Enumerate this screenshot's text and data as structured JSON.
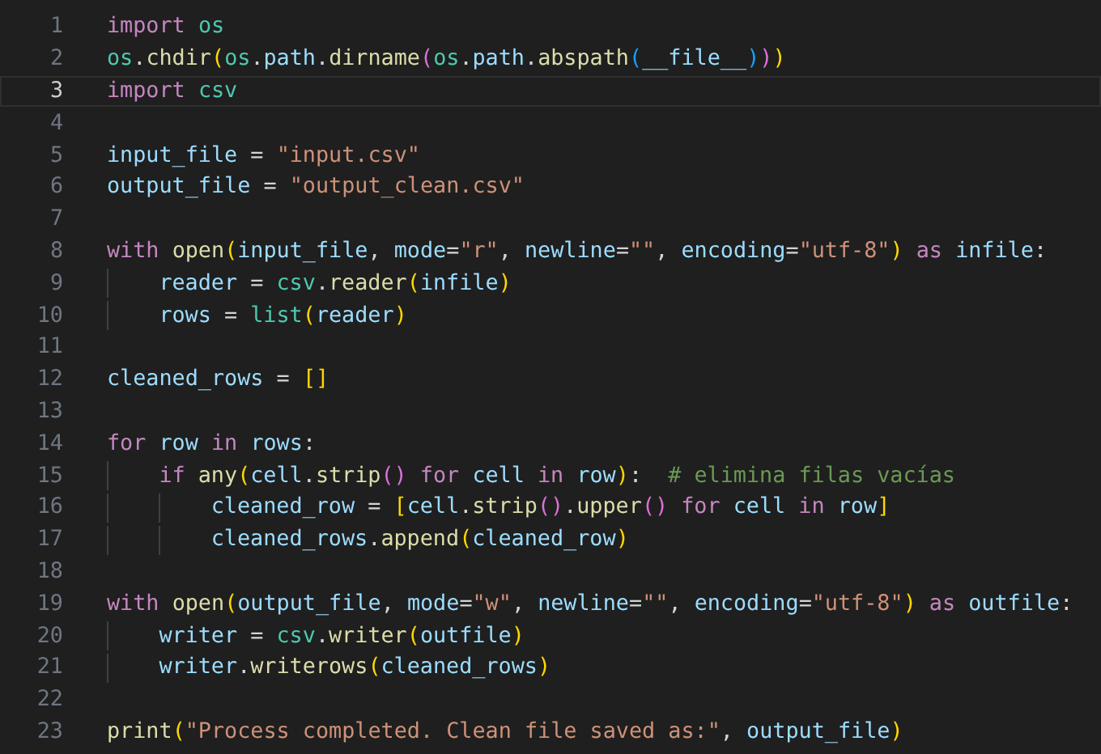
{
  "editor": {
    "lines": [
      {
        "number": "1",
        "current": false,
        "tokens": [
          {
            "kind": "kw",
            "text": "import "
          },
          {
            "kind": "mod",
            "text": "os"
          }
        ]
      },
      {
        "number": "2",
        "current": false,
        "tokens": [
          {
            "kind": "mod",
            "text": "os"
          },
          {
            "kind": "p",
            "text": "."
          },
          {
            "kind": "fn",
            "text": "chdir"
          },
          {
            "kind": "b1",
            "text": "("
          },
          {
            "kind": "mod",
            "text": "os"
          },
          {
            "kind": "p",
            "text": "."
          },
          {
            "kind": "var",
            "text": "path"
          },
          {
            "kind": "p",
            "text": "."
          },
          {
            "kind": "fn",
            "text": "dirname"
          },
          {
            "kind": "b2",
            "text": "("
          },
          {
            "kind": "mod",
            "text": "os"
          },
          {
            "kind": "p",
            "text": "."
          },
          {
            "kind": "var",
            "text": "path"
          },
          {
            "kind": "p",
            "text": "."
          },
          {
            "kind": "fn",
            "text": "abspath"
          },
          {
            "kind": "b3",
            "text": "("
          },
          {
            "kind": "var",
            "text": "__file__"
          },
          {
            "kind": "b3",
            "text": ")"
          },
          {
            "kind": "b2",
            "text": ")"
          },
          {
            "kind": "b1",
            "text": ")"
          }
        ]
      },
      {
        "number": "3",
        "current": true,
        "tokens": [
          {
            "kind": "kw",
            "text": "import "
          },
          {
            "kind": "mod",
            "text": "csv"
          }
        ]
      },
      {
        "number": "4",
        "current": false
      },
      {
        "number": "5",
        "current": false,
        "tokens": [
          {
            "kind": "var",
            "text": "input_file"
          },
          {
            "kind": "p",
            "text": " = "
          },
          {
            "kind": "str",
            "text": "\"input.csv\""
          }
        ]
      },
      {
        "number": "6",
        "current": false,
        "tokens": [
          {
            "kind": "var",
            "text": "output_file"
          },
          {
            "kind": "p",
            "text": " = "
          },
          {
            "kind": "str",
            "text": "\"output_clean.csv\""
          }
        ]
      },
      {
        "number": "7",
        "current": false
      },
      {
        "number": "8",
        "current": false,
        "tokens": [
          {
            "kind": "kw",
            "text": "with "
          },
          {
            "kind": "fn",
            "text": "open"
          },
          {
            "kind": "b1",
            "text": "("
          },
          {
            "kind": "var",
            "text": "input_file"
          },
          {
            "kind": "p",
            "text": ", "
          },
          {
            "kind": "var",
            "text": "mode"
          },
          {
            "kind": "p",
            "text": "="
          },
          {
            "kind": "str",
            "text": "\"r\""
          },
          {
            "kind": "p",
            "text": ", "
          },
          {
            "kind": "var",
            "text": "newline"
          },
          {
            "kind": "p",
            "text": "="
          },
          {
            "kind": "str",
            "text": "\"\""
          },
          {
            "kind": "p",
            "text": ", "
          },
          {
            "kind": "var",
            "text": "encoding"
          },
          {
            "kind": "p",
            "text": "="
          },
          {
            "kind": "str",
            "text": "\"utf-8\""
          },
          {
            "kind": "b1",
            "text": ")"
          },
          {
            "kind": "kw",
            "text": " as "
          },
          {
            "kind": "var",
            "text": "infile"
          },
          {
            "kind": "p",
            "text": ":"
          }
        ],
        "children": [
          {
            "number": "9",
            "current": false,
            "tokens": [
              {
                "kind": "var",
                "text": "reader"
              },
              {
                "kind": "p",
                "text": " = "
              },
              {
                "kind": "mod",
                "text": "csv"
              },
              {
                "kind": "p",
                "text": "."
              },
              {
                "kind": "fn",
                "text": "reader"
              },
              {
                "kind": "b1",
                "text": "("
              },
              {
                "kind": "var",
                "text": "infile"
              },
              {
                "kind": "b1",
                "text": ")"
              }
            ]
          },
          {
            "number": "10",
            "current": false,
            "tokens": [
              {
                "kind": "var",
                "text": "rows"
              },
              {
                "kind": "p",
                "text": " = "
              },
              {
                "kind": "mod",
                "text": "list"
              },
              {
                "kind": "b1",
                "text": "("
              },
              {
                "kind": "var",
                "text": "reader"
              },
              {
                "kind": "b1",
                "text": ")"
              }
            ]
          }
        ]
      },
      {
        "number": "11",
        "current": false
      },
      {
        "number": "12",
        "current": false,
        "tokens": [
          {
            "kind": "var",
            "text": "cleaned_rows"
          },
          {
            "kind": "p",
            "text": " = "
          },
          {
            "kind": "b1",
            "text": "[]"
          }
        ]
      },
      {
        "number": "13",
        "current": false
      },
      {
        "number": "14",
        "current": false,
        "tokens": [
          {
            "kind": "kw",
            "text": "for "
          },
          {
            "kind": "var",
            "text": "row"
          },
          {
            "kind": "kw",
            "text": " in "
          },
          {
            "kind": "var",
            "text": "rows"
          },
          {
            "kind": "p",
            "text": ":"
          }
        ],
        "children": [
          {
            "number": "15",
            "current": false,
            "tokens": [
              {
                "kind": "kw",
                "text": "if "
              },
              {
                "kind": "fn",
                "text": "any"
              },
              {
                "kind": "b1",
                "text": "("
              },
              {
                "kind": "var",
                "text": "cell"
              },
              {
                "kind": "p",
                "text": "."
              },
              {
                "kind": "fn",
                "text": "strip"
              },
              {
                "kind": "b2",
                "text": "()"
              },
              {
                "kind": "kw",
                "text": " for "
              },
              {
                "kind": "var",
                "text": "cell"
              },
              {
                "kind": "kw",
                "text": " in "
              },
              {
                "kind": "var",
                "text": "row"
              },
              {
                "kind": "b1",
                "text": ")"
              },
              {
                "kind": "p",
                "text": ":  "
              },
              {
                "kind": "cm",
                "text": "# elimina filas vacías"
              }
            ],
            "children": [
              {
                "number": "16",
                "current": false,
                "tokens": [
                  {
                    "kind": "var",
                    "text": "cleaned_row"
                  },
                  {
                    "kind": "p",
                    "text": " = "
                  },
                  {
                    "kind": "b1",
                    "text": "["
                  },
                  {
                    "kind": "var",
                    "text": "cell"
                  },
                  {
                    "kind": "p",
                    "text": "."
                  },
                  {
                    "kind": "fn",
                    "text": "strip"
                  },
                  {
                    "kind": "b2",
                    "text": "()"
                  },
                  {
                    "kind": "p",
                    "text": "."
                  },
                  {
                    "kind": "fn",
                    "text": "upper"
                  },
                  {
                    "kind": "b2",
                    "text": "()"
                  },
                  {
                    "kind": "kw",
                    "text": " for "
                  },
                  {
                    "kind": "var",
                    "text": "cell"
                  },
                  {
                    "kind": "kw",
                    "text": " in "
                  },
                  {
                    "kind": "var",
                    "text": "row"
                  },
                  {
                    "kind": "b1",
                    "text": "]"
                  }
                ]
              },
              {
                "number": "17",
                "current": false,
                "tokens": [
                  {
                    "kind": "var",
                    "text": "cleaned_rows"
                  },
                  {
                    "kind": "p",
                    "text": "."
                  },
                  {
                    "kind": "fn",
                    "text": "append"
                  },
                  {
                    "kind": "b1",
                    "text": "("
                  },
                  {
                    "kind": "var",
                    "text": "cleaned_row"
                  },
                  {
                    "kind": "b1",
                    "text": ")"
                  }
                ]
              }
            ]
          }
        ]
      },
      {
        "number": "18",
        "current": false
      },
      {
        "number": "19",
        "current": false,
        "tokens": [
          {
            "kind": "kw",
            "text": "with "
          },
          {
            "kind": "fn",
            "text": "open"
          },
          {
            "kind": "b1",
            "text": "("
          },
          {
            "kind": "var",
            "text": "output_file"
          },
          {
            "kind": "p",
            "text": ", "
          },
          {
            "kind": "var",
            "text": "mode"
          },
          {
            "kind": "p",
            "text": "="
          },
          {
            "kind": "str",
            "text": "\"w\""
          },
          {
            "kind": "p",
            "text": ", "
          },
          {
            "kind": "var",
            "text": "newline"
          },
          {
            "kind": "p",
            "text": "="
          },
          {
            "kind": "str",
            "text": "\"\""
          },
          {
            "kind": "p",
            "text": ", "
          },
          {
            "kind": "var",
            "text": "encoding"
          },
          {
            "kind": "p",
            "text": "="
          },
          {
            "kind": "str",
            "text": "\"utf-8\""
          },
          {
            "kind": "b1",
            "text": ")"
          },
          {
            "kind": "kw",
            "text": " as "
          },
          {
            "kind": "var",
            "text": "outfile"
          },
          {
            "kind": "p",
            "text": ":"
          }
        ],
        "children": [
          {
            "number": "20",
            "current": false,
            "tokens": [
              {
                "kind": "var",
                "text": "writer"
              },
              {
                "kind": "p",
                "text": " = "
              },
              {
                "kind": "mod",
                "text": "csv"
              },
              {
                "kind": "p",
                "text": "."
              },
              {
                "kind": "fn",
                "text": "writer"
              },
              {
                "kind": "b1",
                "text": "("
              },
              {
                "kind": "var",
                "text": "outfile"
              },
              {
                "kind": "b1",
                "text": ")"
              }
            ]
          },
          {
            "number": "21",
            "current": false,
            "tokens": [
              {
                "kind": "var",
                "text": "writer"
              },
              {
                "kind": "p",
                "text": "."
              },
              {
                "kind": "fn",
                "text": "writerows"
              },
              {
                "kind": "b1",
                "text": "("
              },
              {
                "kind": "var",
                "text": "cleaned_rows"
              },
              {
                "kind": "b1",
                "text": ")"
              }
            ]
          }
        ]
      },
      {
        "number": "22",
        "current": false
      },
      {
        "number": "23",
        "current": false,
        "tokens": [
          {
            "kind": "fn",
            "text": "print"
          },
          {
            "kind": "b1",
            "text": "("
          },
          {
            "kind": "str",
            "text": "\"Process completed. Clean file saved as:\""
          },
          {
            "kind": "p",
            "text": ", "
          },
          {
            "kind": "var",
            "text": "output_file"
          },
          {
            "kind": "b1",
            "text": ")"
          }
        ]
      }
    ]
  }
}
